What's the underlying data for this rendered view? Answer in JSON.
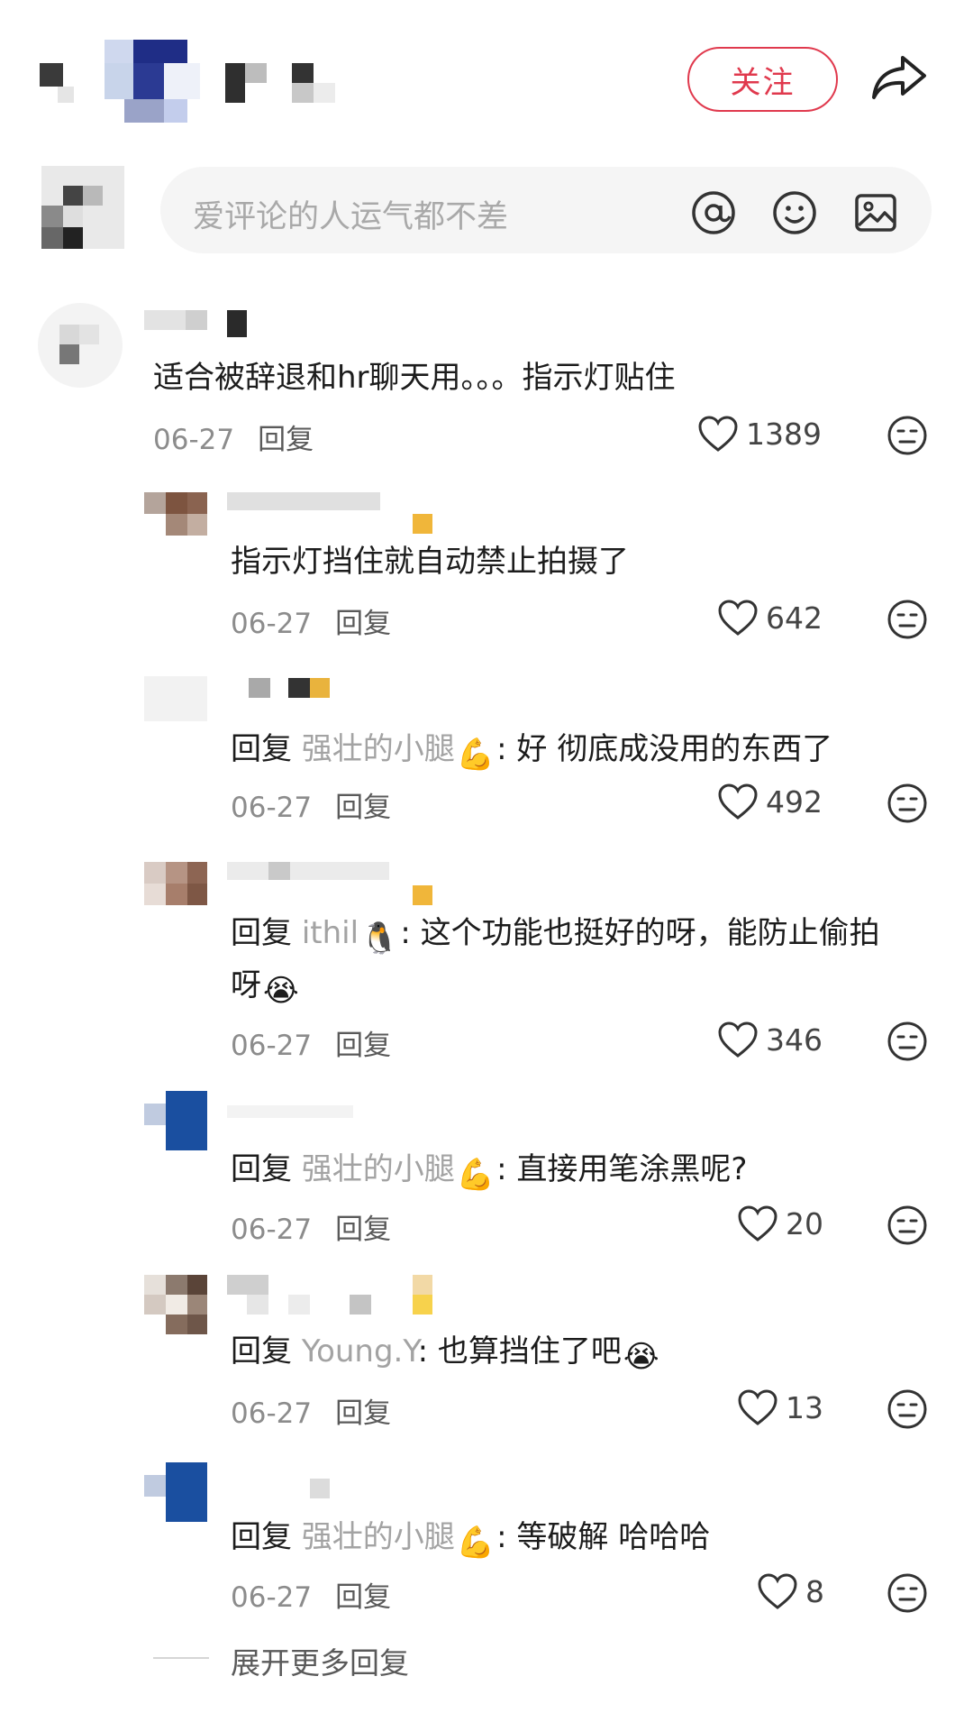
{
  "header": {
    "follow_label": "关注"
  },
  "input": {
    "placeholder": "爱评论的人运气都不差"
  },
  "comments": [
    {
      "text": "适合被辞退和hr聊天用。。。指示灯贴住",
      "date": "06-27",
      "reply_label": "回复",
      "likes": "1389"
    },
    {
      "text": "指示灯挡住就自动禁止拍摄了",
      "date": "06-27",
      "reply_label": "回复",
      "likes": "642"
    },
    {
      "prefix": "回复",
      "reply_to": "强壮的小腿",
      "text": ": 好 彻底成没用的东西了",
      "date": "06-27",
      "reply_label": "回复",
      "likes": "492"
    },
    {
      "prefix": "回复",
      "reply_to": "ithil",
      "text": ": 这个功能也挺好的呀，能防止偷拍",
      "text2": "呀",
      "date": "06-27",
      "reply_label": "回复",
      "likes": "346"
    },
    {
      "prefix": "回复",
      "reply_to": "强壮的小腿",
      "text": ": 直接用笔涂黑呢?",
      "date": "06-27",
      "reply_label": "回复",
      "likes": "20"
    },
    {
      "prefix": "回复",
      "reply_to": "Young.Y",
      "text": ": 也算挡住了吧",
      "date": "06-27",
      "reply_label": "回复",
      "likes": "13"
    },
    {
      "prefix": "回复",
      "reply_to": "强壮的小腿",
      "text": ": 等破解 哈哈哈",
      "date": "06-27",
      "reply_label": "回复",
      "likes": "8"
    }
  ],
  "expand_more": "展开更多回复",
  "colors": {
    "accent": "#e0394d"
  }
}
